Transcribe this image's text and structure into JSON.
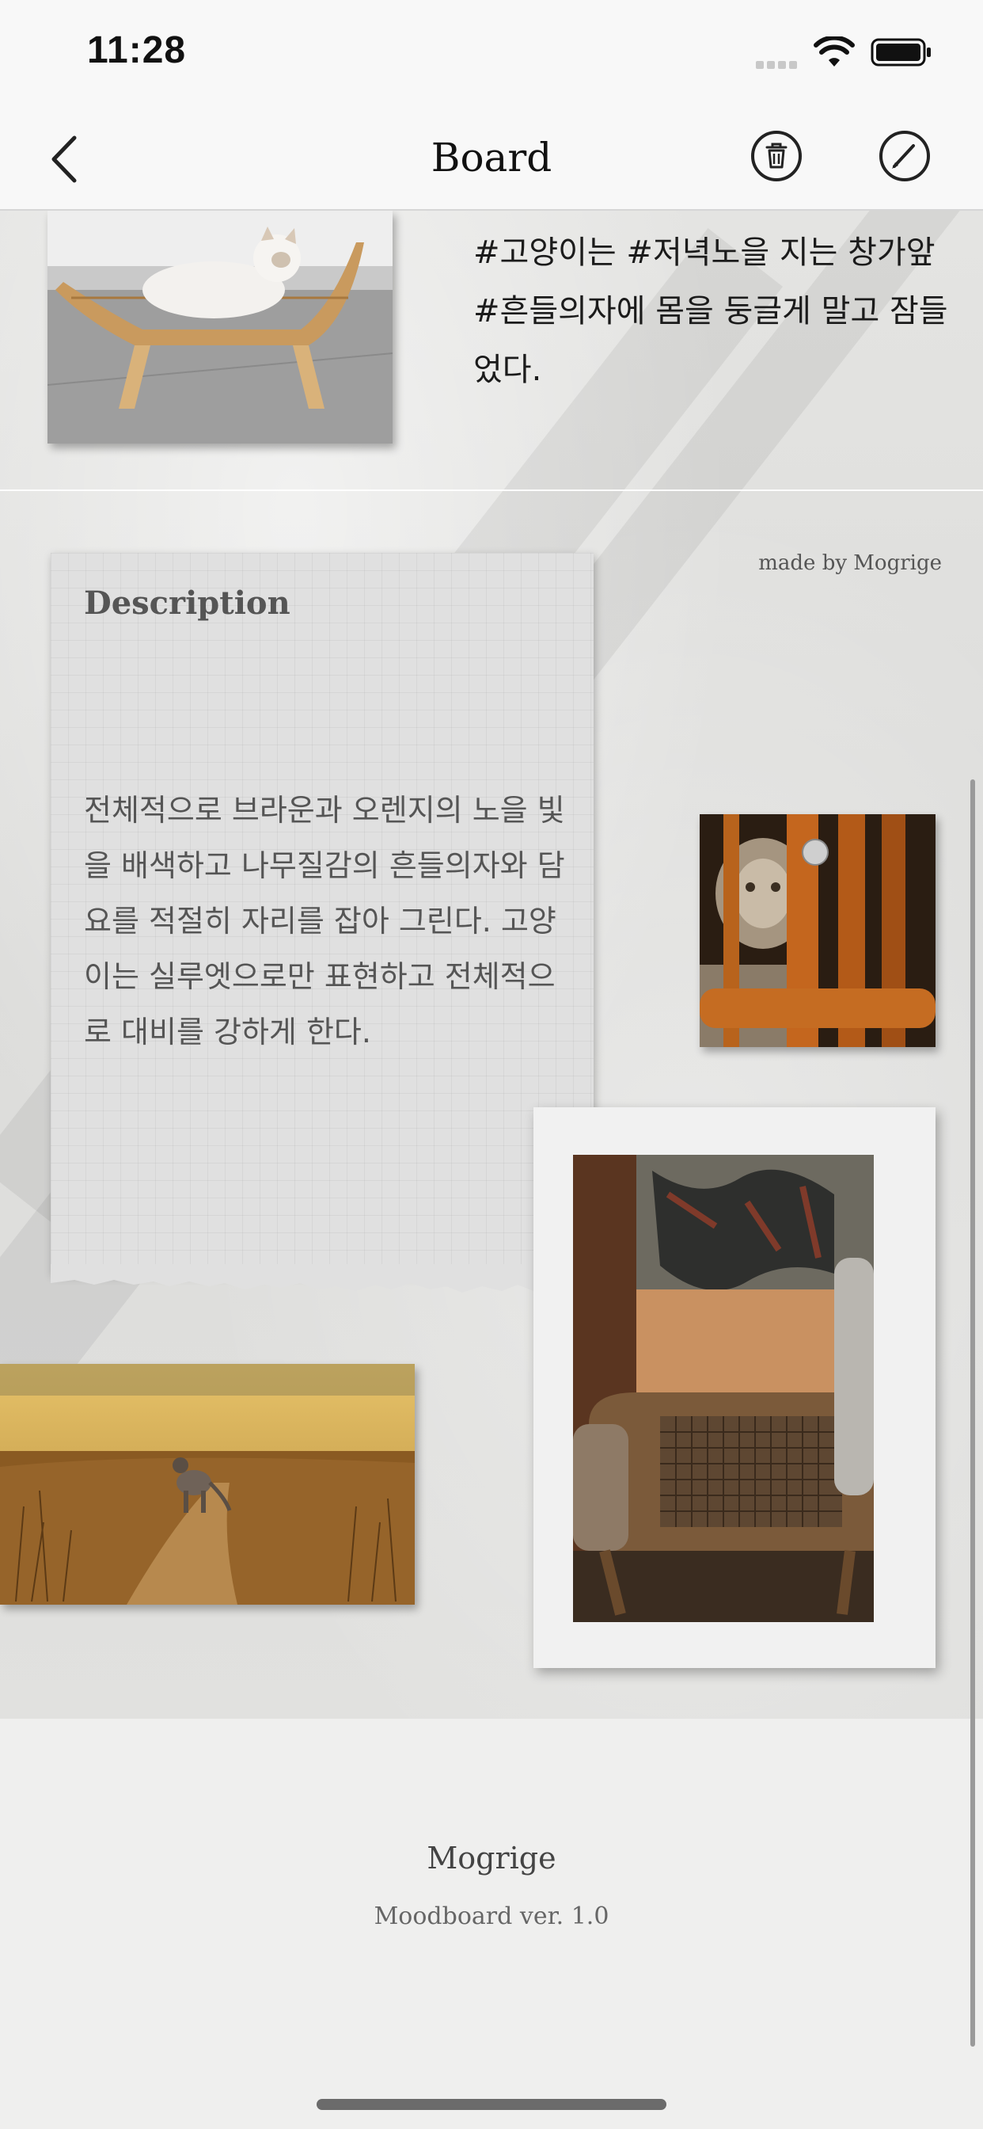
{
  "status_bar": {
    "time": "11:28"
  },
  "nav": {
    "title": "Board"
  },
  "board": {
    "caption": "#고양이는 #저녁노을 지는 창가앞 #흔들의자에 몸을 둥글게 말고 잠들었다.",
    "made_by": "made by Mogrige",
    "description": {
      "title": "Description",
      "body": "전체적으로 브라운과 오렌지의 노을 빛을 배색하고 나무질감의 흔들의자와 담요를 적절히 자리를 잡아 그린다. 고양이는 실루엣으로만 표현하고 전체적으로 대비를 강하게 한다."
    }
  },
  "footer": {
    "app_name": "Mogrige",
    "version": "Moodboard ver. 1.0"
  },
  "colors": {
    "background": "#efefee",
    "nav_bg": "#f8f8f8",
    "text": "#111111"
  },
  "icons": [
    "back-chevron-icon",
    "trash-icon",
    "pencil-icon",
    "wifi-icon",
    "battery-icon"
  ]
}
